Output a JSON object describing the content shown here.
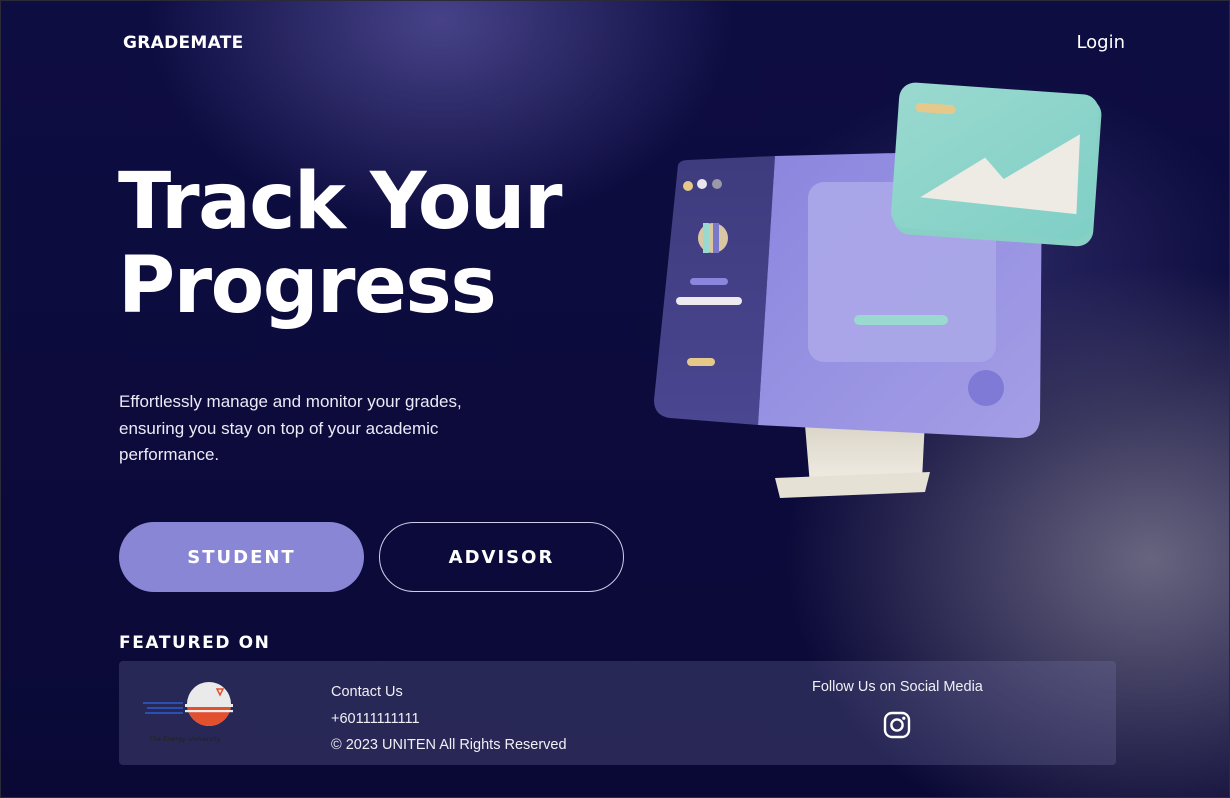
{
  "header": {
    "brand": "GRADEMATE",
    "login_label": "Login"
  },
  "hero": {
    "title_line1": "Track Your",
    "title_line2": "Progress",
    "description": "Effortlessly manage and monitor your grades, ensuring you stay on top of your academic performance."
  },
  "actions": {
    "student_label": "STUDENT",
    "advisor_label": "ADVISOR"
  },
  "featured": {
    "heading": "FEATURED ON",
    "logo_tagline": "The Energy University"
  },
  "footer": {
    "contact_heading": "Contact Us",
    "phone": "+60111111111",
    "copyright": "© 2023 UNITEN All Rights Reserved",
    "social_heading": "Follow Us on Social Media"
  },
  "icons": {
    "social": "instagram-icon",
    "illustration": "computer-monitor-illustration"
  },
  "colors": {
    "accent": "#8a86d6",
    "background": "#0e0d42"
  }
}
